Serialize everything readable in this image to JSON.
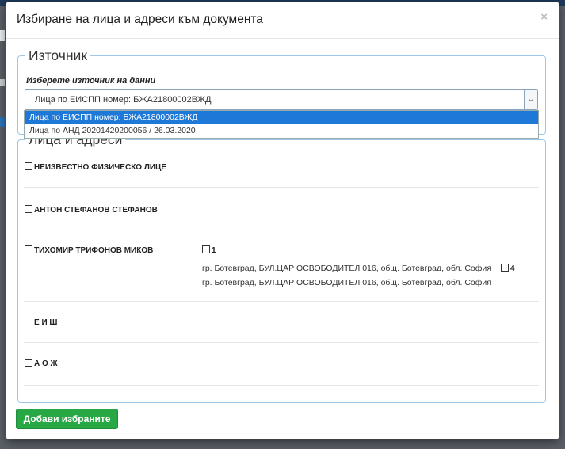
{
  "modal": {
    "title": "Избиране на лица и адреси към документа",
    "close": "×"
  },
  "source": {
    "legend": "Източник",
    "label": "Изберете източник на данни",
    "selected": "Лица по ЕИСПП номер: БЖА21800002ВЖД",
    "options": [
      "Лица по ЕИСПП номер: БЖА21800002ВЖД",
      "Лица по АНД 20201420200056 / 26.03.2020"
    ]
  },
  "people": {
    "legend": "Лица и адреси",
    "list": [
      "НЕИЗВЕСТНО ФИЗИЧЕСКО ЛИЦЕ",
      "АНТОН СТЕФАНОВ СТЕФАНОВ",
      "ТИХОМИР ТРИФОНОВ МИКОВ",
      "Е И Ш",
      "А О Ж"
    ],
    "addresses": [
      {
        "id": "1",
        "text": "гр. Ботевград, БУЛ.ЦАР ОСВОБОДИТЕЛ 016, общ. Ботевград, обл. София"
      },
      {
        "id": "4",
        "text": "гр. Ботевград, БУЛ.ЦАР ОСВОБОДИТЕЛ 016, общ. Ботевград, обл. София"
      }
    ]
  },
  "actions": {
    "add_selected": "Добави избраните"
  },
  "colors": {
    "primary_button": "#28a745",
    "selected_option": "#1e78d7",
    "fieldset_border": "#9cc7e6"
  },
  "icons": {
    "close": "close-icon",
    "dropdown": "chevron-down-icon",
    "checkbox": "checkbox-icon"
  }
}
